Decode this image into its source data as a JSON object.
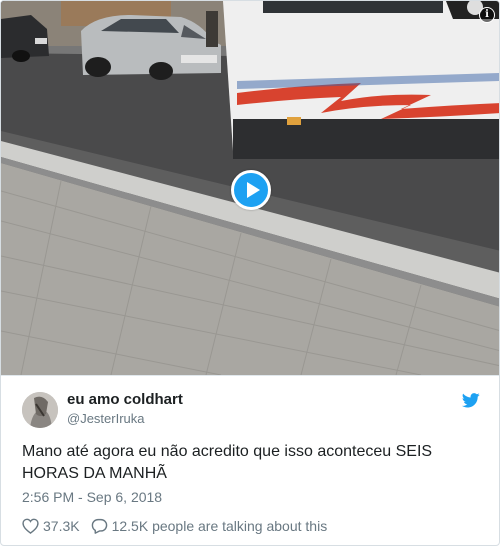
{
  "media": {
    "type": "video",
    "play_icon": "play-icon",
    "info_icon": "info-icon",
    "info_glyph": "i",
    "accent_color": "#1da1f2"
  },
  "tweet": {
    "author": {
      "name": "eu amo coldhart",
      "handle": "@JesterIruka",
      "avatar_icon": "avatar"
    },
    "brand_icon": "twitter-bird-icon",
    "text": "Mano até agora eu não acredito que isso aconteceu SEIS HORAS DA MANHÃ",
    "timestamp": "2:56 PM - Sep 6, 2018",
    "likes": "37.3K",
    "replies_text": "12.5K people are talking about this",
    "like_icon": "heart-icon",
    "reply_icon": "speech-bubble-icon",
    "colors": {
      "text": "#1c2022",
      "muted": "#697882",
      "brand": "#1da1f2"
    }
  }
}
